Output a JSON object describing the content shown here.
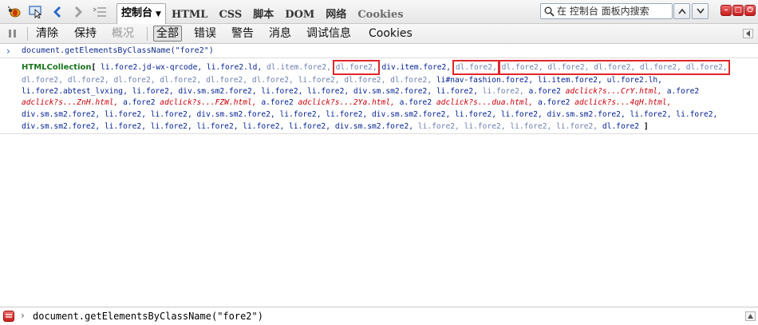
{
  "toolbar": {
    "icons": [
      "firebug-icon",
      "inspect-element-icon",
      "back-arrow-icon",
      "forward-arrow-icon",
      "menu-list-icon"
    ],
    "tabs": [
      {
        "label": "控制台",
        "active": true
      },
      {
        "label": "HTML"
      },
      {
        "label": "CSS"
      },
      {
        "label": "脚本"
      },
      {
        "label": "DOM"
      },
      {
        "label": "网络"
      },
      {
        "label": "Cookies"
      }
    ],
    "search_placeholder": "在 控制台 面板内搜索"
  },
  "filterbar": {
    "items": [
      {
        "label": "清除"
      },
      {
        "label": "保持"
      },
      {
        "label": "概况",
        "disabled": true
      },
      {
        "label": "全部",
        "selected": true
      },
      {
        "label": "错误"
      },
      {
        "label": "警告"
      },
      {
        "label": "消息"
      },
      {
        "label": "调试信息"
      },
      {
        "label": "Cookies"
      }
    ]
  },
  "console": {
    "command": "document.getElementsByClassName(\"fore2\")",
    "result": {
      "label": "HTMLCollection",
      "open": "[",
      "close": "]",
      "lines": [
        [
          {
            "t": "li.fore2.jd-wx-qrcode,",
            "c": "el"
          },
          {
            "t": "li.fore2.ld,",
            "c": "el"
          },
          {
            "t": "dl.item.fore2,",
            "c": "el-gray"
          },
          {
            "t": "dl.fore2,",
            "c": "el-gray"
          },
          {
            "t": "div.item.fore2,",
            "c": "el"
          },
          {
            "t": "dl.fore2,",
            "c": "el-gray"
          },
          {
            "t": "dl.fore2,",
            "c": "el-gray"
          },
          {
            "t": "dl.fore2,",
            "c": "el-gray"
          },
          {
            "t": "dl.fore2,",
            "c": "el-gray"
          },
          {
            "t": "dl.fore2,",
            "c": "el-gray"
          },
          {
            "t": "dl.fore2,",
            "c": "el-gray"
          }
        ],
        [
          {
            "t": "dl.fore2,",
            "c": "el-gray"
          },
          {
            "t": "dl.fore2,",
            "c": "el-gray"
          },
          {
            "t": "dl.fore2,",
            "c": "el-gray"
          },
          {
            "t": "dl.fore2,",
            "c": "el-gray"
          },
          {
            "t": "dl.fore2,",
            "c": "el-gray"
          },
          {
            "t": "dl.fore2,",
            "c": "el-gray"
          },
          {
            "t": "li.fore2,",
            "c": "el-gray"
          },
          {
            "t": "dl.fore2,",
            "c": "el-gray"
          },
          {
            "t": "dl.fore2,",
            "c": "el-gray"
          },
          {
            "t": "li#nav-fashion.fore2,",
            "c": "el"
          },
          {
            "t": "li.item.fore2,",
            "c": "el"
          },
          {
            "t": "ul.fore2.lh,",
            "c": "el"
          }
        ],
        [
          {
            "t": "li.fore2.abtest_lvxing,",
            "c": "el"
          },
          {
            "t": "li.fore2,",
            "c": "el"
          },
          {
            "t": "div.sm.sm2.fore2,",
            "c": "el"
          },
          {
            "t": "li.fore2,",
            "c": "el"
          },
          {
            "t": "li.fore2,",
            "c": "el"
          },
          {
            "t": "div.sm.sm2.fore2,",
            "c": "el"
          },
          {
            "t": "li.fore2,",
            "c": "el"
          },
          {
            "t": "li.fore2,",
            "c": "el-gray"
          },
          {
            "t": "a.fore2",
            "c": "el"
          },
          {
            "t": "adclick?s...CrY.html,",
            "c": "el-link"
          },
          {
            "t": "a.fore2",
            "c": "el"
          }
        ],
        [
          {
            "t": "adclick?s...ZnH.html,",
            "c": "el-link"
          },
          {
            "t": "a.fore2",
            "c": "el"
          },
          {
            "t": "adclick?s...FZW.html,",
            "c": "el-link"
          },
          {
            "t": "a.fore2",
            "c": "el"
          },
          {
            "t": "adclick?s...2Ya.html,",
            "c": "el-link"
          },
          {
            "t": "a.fore2",
            "c": "el"
          },
          {
            "t": "adclick?s...dua.html,",
            "c": "el-link"
          },
          {
            "t": "a.fore2",
            "c": "el"
          },
          {
            "t": "adclick?s...4qH.html,",
            "c": "el-link"
          }
        ],
        [
          {
            "t": "div.sm.sm2.fore2,",
            "c": "el"
          },
          {
            "t": "li.fore2,",
            "c": "el"
          },
          {
            "t": "li.fore2,",
            "c": "el"
          },
          {
            "t": "div.sm.sm2.fore2,",
            "c": "el"
          },
          {
            "t": "li.fore2,",
            "c": "el"
          },
          {
            "t": "li.fore2,",
            "c": "el"
          },
          {
            "t": "div.sm.sm2.fore2,",
            "c": "el"
          },
          {
            "t": "li.fore2,",
            "c": "el"
          },
          {
            "t": "li.fore2,",
            "c": "el"
          },
          {
            "t": "div.sm.sm2.fore2,",
            "c": "el"
          },
          {
            "t": "li.fore2,",
            "c": "el"
          },
          {
            "t": "li.fore2,",
            "c": "el"
          }
        ],
        [
          {
            "t": "div.sm.sm2.fore2,",
            "c": "el"
          },
          {
            "t": "li.fore2,",
            "c": "el"
          },
          {
            "t": "li.fore2,",
            "c": "el"
          },
          {
            "t": "li.fore2,",
            "c": "el"
          },
          {
            "t": "li.fore2,",
            "c": "el"
          },
          {
            "t": "li.fore2,",
            "c": "el"
          },
          {
            "t": "div.sm.sm2.fore2,",
            "c": "el"
          },
          {
            "t": "li.fore2,",
            "c": "el-gray"
          },
          {
            "t": "li.fore2,",
            "c": "el-gray"
          },
          {
            "t": "li.fore2,",
            "c": "el-gray"
          },
          {
            "t": "li.fore2,",
            "c": "el-gray"
          },
          {
            "t": "dl.fore2",
            "c": "el"
          }
        ]
      ]
    }
  },
  "command_line": {
    "value": "document.getElementsByClassName(\"fore2\")"
  },
  "colors": {
    "highlight_box": "#e0262b",
    "collection_label": "#18741c",
    "element_text": "#001f8f"
  }
}
